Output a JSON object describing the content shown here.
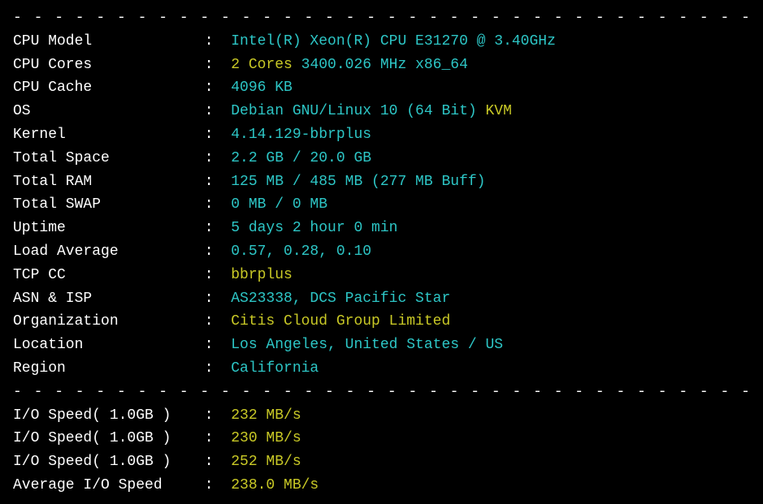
{
  "divider": "- - - - - - - - - - - - - - - - - - - - - - - - - - - - - - - - - - - - - - - - - - - - - -",
  "system": {
    "cpu_model_label": "CPU Model",
    "cpu_model_value": "Intel(R) Xeon(R) CPU E31270 @ 3.40GHz",
    "cpu_cores_label": "CPU Cores",
    "cpu_cores_value1": "2 Cores",
    "cpu_cores_value2": " 3400.026 MHz x86_64",
    "cpu_cache_label": "CPU Cache",
    "cpu_cache_value": "4096 KB",
    "os_label": "OS",
    "os_value1": "Debian GNU/Linux 10 (64 Bit)",
    "os_value2": " KVM",
    "kernel_label": "Kernel",
    "kernel_value": "4.14.129-bbrplus",
    "total_space_label": "Total Space",
    "total_space_value": "2.2 GB / 20.0 GB",
    "total_ram_label": "Total RAM",
    "total_ram_value": "125 MB / 485 MB (277 MB Buff)",
    "total_swap_label": "Total SWAP",
    "total_swap_value": "0 MB / 0 MB",
    "uptime_label": "Uptime",
    "uptime_value": "5 days 2 hour 0 min",
    "load_avg_label": "Load Average",
    "load_avg_value": "0.57, 0.28, 0.10",
    "tcp_cc_label": "TCP CC",
    "tcp_cc_value": "bbrplus",
    "asn_isp_label": "ASN & ISP",
    "asn_isp_value": "AS23338, DCS Pacific Star",
    "org_label": "Organization",
    "org_value": "Citis Cloud Group Limited",
    "location_label": "Location",
    "location_value": "Los Angeles, United States / US",
    "region_label": "Region",
    "region_value": "California"
  },
  "io": {
    "speed1_label": "I/O Speed( 1.0GB )",
    "speed1_value": "232 MB/s",
    "speed2_label": "I/O Speed( 1.0GB )",
    "speed2_value": "230 MB/s",
    "speed3_label": "I/O Speed( 1.0GB )",
    "speed3_value": "252 MB/s",
    "avg_label": "Average I/O Speed",
    "avg_value": "238.0 MB/s"
  },
  "colon": " :  "
}
